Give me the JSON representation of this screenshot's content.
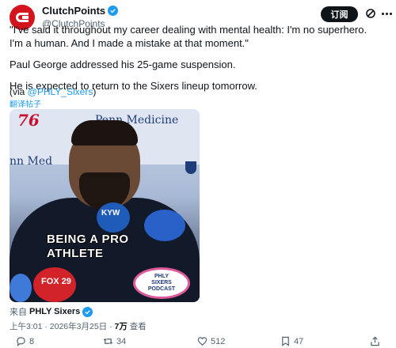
{
  "author": {
    "display_name": "ClutchPoints",
    "handle": "@ClutchPoints",
    "avatar_icon": "clutchpoints-logo-icon",
    "verified_icon": "verified-badge-icon"
  },
  "header": {
    "subscribe_label": "订阅",
    "grok_icon": "grok-icon",
    "more_icon": "more-icon"
  },
  "tweet": {
    "paragraphs": [
      "\"I've said it throughout my career dealing with mental health: I'm no superhero. I'm a human. And I made a mistake at that moment.\"",
      "Paul George addressed his 25-game suspension.",
      "He is expected to return to the Sixers lineup tomorrow."
    ],
    "via_prefix": "(via ",
    "via_link": "@PHLY_Sixers",
    "via_suffix": ")",
    "translate_label": "翻译帖子"
  },
  "media": {
    "caption_line1": "BEING A PRO",
    "caption_line2": "ATHLETE",
    "logo_76": "76",
    "banner_text_1": "Penn Medicine",
    "banner_text_2": "nn Med",
    "mic_kyw": "KYW",
    "mic_fox": "FOX 29",
    "podcast_line1": "PHLY",
    "podcast_line2": "SIXERS",
    "podcast_line3": "PODCAST"
  },
  "source": {
    "prefix": "来自",
    "name": "PHLY Sixers",
    "verified_icon": "verified-badge-icon"
  },
  "meta": {
    "time": "上午3:01",
    "date": "2026年3月25日",
    "views_count": "7万",
    "views_label": "查看"
  },
  "actions": {
    "reply_icon": "reply-icon",
    "reply_count": "8",
    "repost_icon": "repost-icon",
    "repost_count": "34",
    "like_icon": "heart-icon",
    "like_count": "512",
    "bookmark_icon": "bookmark-icon",
    "bookmark_count": "47",
    "share_icon": "share-icon"
  },
  "colors": {
    "accent": "#1d9bf0",
    "brand_red": "#d4141c",
    "text_primary": "#0f1419",
    "text_secondary": "#536471"
  }
}
